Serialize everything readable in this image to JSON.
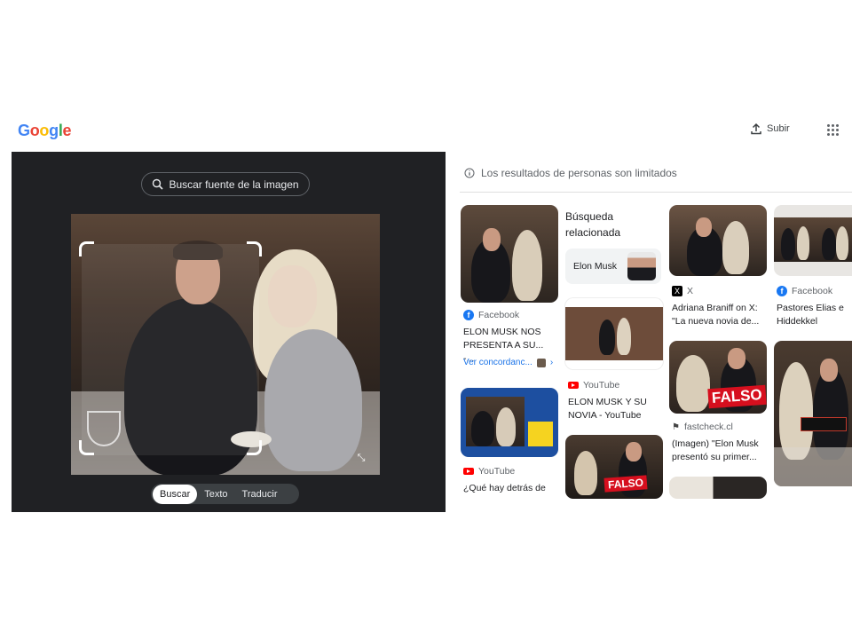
{
  "header": {
    "logo": "Google",
    "upload_label": "Subir"
  },
  "left": {
    "source_button": "Buscar fuente de la imagen",
    "tabs": [
      "Buscar",
      "Texto",
      "Traducir"
    ],
    "active_tab": "Buscar"
  },
  "results": {
    "notice": "Los resultados de personas son limitados",
    "related": {
      "title": "Búsqueda relacionada",
      "item": "Elon Musk"
    },
    "col1": {
      "r1": {
        "source": "Facebook",
        "title": "ELON MUSK NOS PRESENTA A SU... -...",
        "link": "Ver concordanc..."
      },
      "r2": {
        "source": "YouTube",
        "title": "¿Qué hay detrás de"
      }
    },
    "col2": {
      "r1": {
        "source": "YouTube",
        "title": "ELON MUSK Y SU NOVIA - YouTube"
      },
      "falso": "FALSO"
    },
    "col3": {
      "r1": {
        "source": "X",
        "title": "Adriana Braniff on X: \"La nueva novia de..."
      },
      "r2": {
        "source": "fastcheck.cl",
        "title": "(Imagen) \"Elon Musk presentó su primer..."
      },
      "falso": "FALSO"
    },
    "col4": {
      "r1": {
        "source": "Facebook",
        "title": "Pastores Elias e Hiddekkel Paulino"
      }
    }
  },
  "colors": {
    "panel_bg": "#202124",
    "link": "#1a73e8",
    "falso_red": "#d60f1e"
  }
}
